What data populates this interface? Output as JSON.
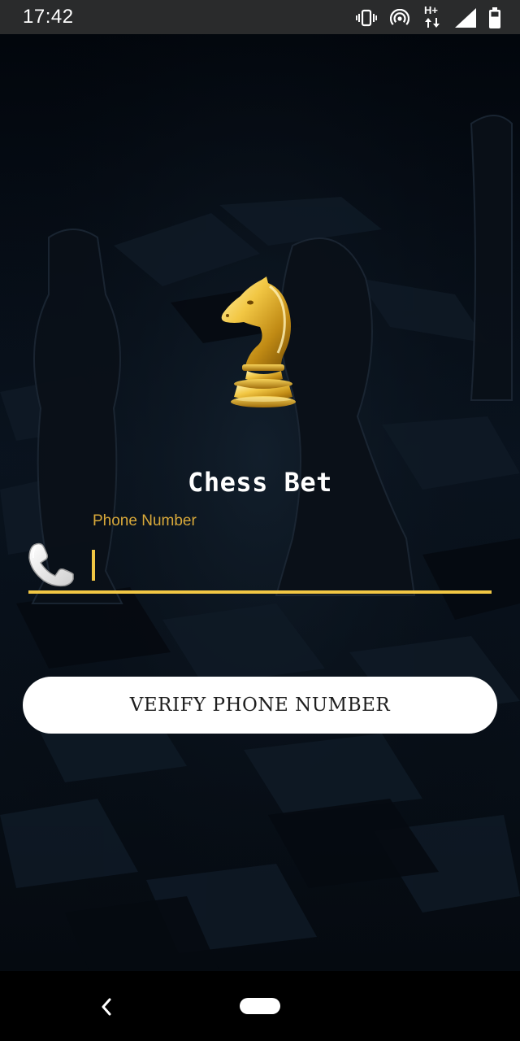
{
  "status_bar": {
    "time": "17:42",
    "network_label": "H+",
    "icons": [
      "vibrate-icon",
      "hotspot-icon",
      "network-hplus-icon",
      "signal-icon",
      "battery-icon"
    ]
  },
  "app": {
    "title": "Chess Bet",
    "logo": "gold-knight-icon"
  },
  "form": {
    "phone_label": "Phone Number",
    "phone_value": "",
    "phone_placeholder": "",
    "phone_icon": "phone-icon",
    "verify_button_label": "VERIFY PHONE NUMBER"
  },
  "nav_bar": {
    "back_icon": "back-chevron-icon",
    "home_icon": "home-pill-icon"
  },
  "colors": {
    "accent": "#f2c744",
    "label": "#d9a93a",
    "background": "#03070d",
    "button_bg": "#ffffff",
    "status_bar": "#2a2b2c"
  }
}
